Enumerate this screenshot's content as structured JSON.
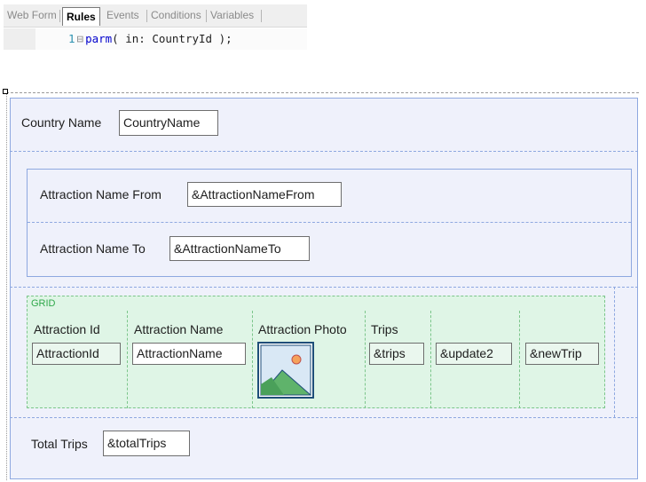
{
  "tabs": [
    {
      "label": "Web Form",
      "active": false
    },
    {
      "label": "Rules",
      "active": true
    },
    {
      "label": "Events",
      "active": false
    },
    {
      "label": "Conditions",
      "active": false
    },
    {
      "label": "Variables",
      "active": false
    }
  ],
  "code": {
    "line_number": "1",
    "keyword": "parm",
    "rest": "( in: CountryId );"
  },
  "form": {
    "country": {
      "label": "Country Name",
      "value": "CountryName"
    },
    "filters": {
      "from": {
        "label": "Attraction Name From",
        "value": "&AttractionNameFrom"
      },
      "to": {
        "label": "Attraction Name To",
        "value": "&AttractionNameTo"
      }
    },
    "grid": {
      "title": "GRID",
      "columns": [
        {
          "header": "Attraction Id",
          "value": "AttractionId"
        },
        {
          "header": "Attraction Name",
          "value": "AttractionName"
        },
        {
          "header": "Attraction Photo",
          "value": "",
          "icon": "image-icon"
        },
        {
          "header": "Trips",
          "value": "&trips"
        },
        {
          "header": "",
          "value": "&update2"
        },
        {
          "header": "",
          "value": "&newTrip"
        }
      ]
    },
    "total": {
      "label": "Total Trips",
      "value": "&totalTrips"
    }
  },
  "colors": {
    "panel_border": "#8ea8e0",
    "panel_bg": "#eff1fb",
    "grid_bg": "#dff5e6",
    "grid_border": "#7bc58a",
    "keyword": "#0000cc"
  }
}
